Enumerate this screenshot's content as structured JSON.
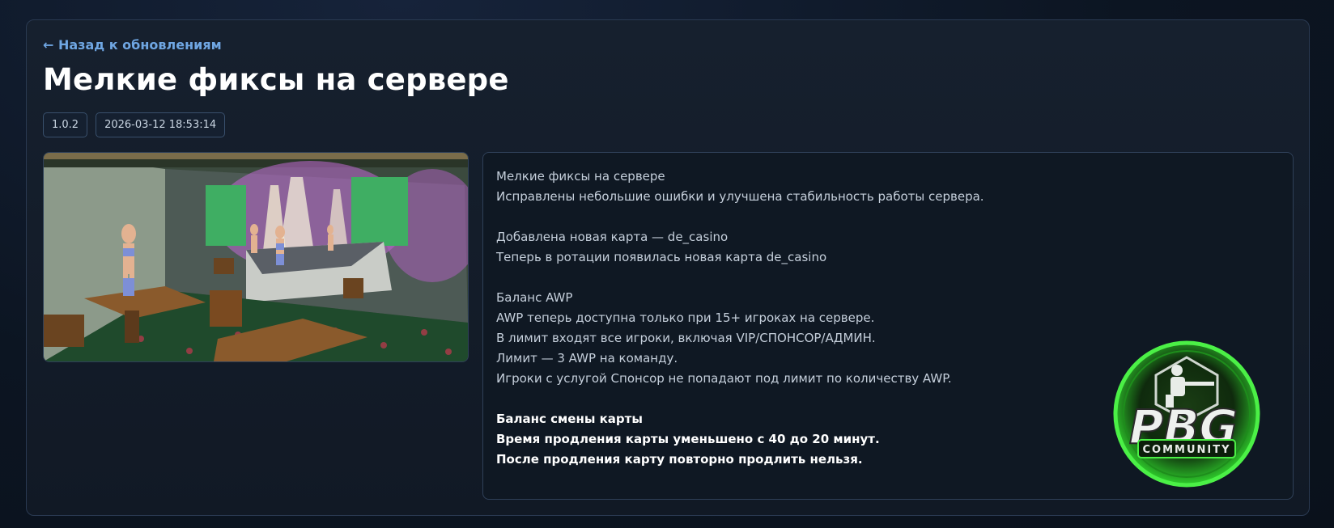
{
  "nav": {
    "back_label": "← Назад к обновлениям"
  },
  "update": {
    "title": "Мелкие фиксы на сервере",
    "version": "1.0.2",
    "datetime": "2026-03-12 18:53:14"
  },
  "screenshot": {
    "icon": "map-screenshot"
  },
  "description": {
    "lines": [
      "Мелкие фиксы на сервере",
      "Исправлены небольшие ошибки и улучшена стабильность работы сервера.",
      "",
      "Добавлена новая карта — de_casino",
      "Теперь в ротации появилась новая карта de_casino",
      "",
      "Баланс AWP",
      "AWP теперь доступна только при 15+ игроках на сервере.",
      "В лимит входят все игроки, включая VIP/СПОНСОР/АДМИН.",
      "Лимит — 3 AWP на команду.",
      "Игроки с услугой Спонсор не попадают под лимит по количеству AWP.",
      "",
      "Баланс смены карты",
      "Время продления карты уменьшено с 40 до 20 минут.",
      "После продления карту повторно продлить нельзя."
    ]
  },
  "logo": {
    "main_text": "PBG",
    "sub_text": "COMMUNITY",
    "accent": "#3ee23a"
  },
  "colors": {
    "link": "#6fa6e2",
    "background": "#0c1522",
    "card_border": "#2a3a52"
  }
}
